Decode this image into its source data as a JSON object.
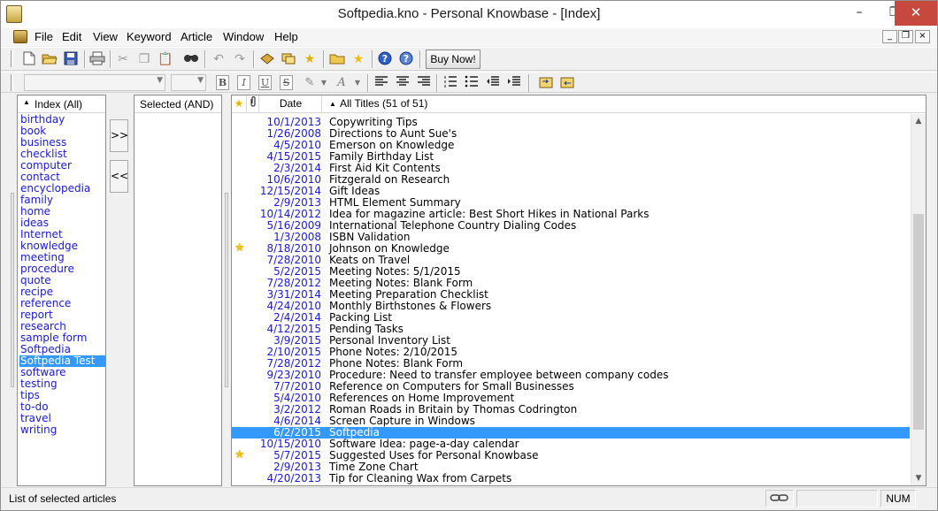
{
  "window": {
    "title": "Softpedia.kno - Personal Knowbase - [Index]",
    "controls": {
      "minimize": "–",
      "restore": "❐",
      "close": "✕"
    }
  },
  "menu": {
    "items": [
      "File",
      "Edit",
      "View",
      "Keyword",
      "Article",
      "Window",
      "Help"
    ],
    "mdi": {
      "minimize": "_",
      "restore": "❐",
      "close": "×"
    }
  },
  "toolbar": {
    "buy_now": "Buy Now!",
    "icons": [
      "new-document-icon",
      "open-folder-icon",
      "save-icon",
      "print-icon",
      "cut-icon",
      "copy-icon",
      "paste-icon",
      "find-icon",
      "undo-icon",
      "redo-icon",
      "knowbase-icon",
      "link-icon",
      "favorites-star-icon",
      "folder-icon",
      "star-icon",
      "help-icon",
      "context-help-icon"
    ],
    "format": {
      "bold": "B",
      "italic": "I",
      "underline": "U",
      "strike": "S"
    }
  },
  "index_panel": {
    "header": "Index (All)",
    "sort_indicator": "▲",
    "items": [
      "birthday",
      "book",
      "business",
      "checklist",
      "computer",
      "contact",
      "encyclopedia",
      "family",
      "home",
      "ideas",
      "Internet",
      "knowledge",
      "meeting",
      "procedure",
      "quote",
      "recipe",
      "reference",
      "report",
      "research",
      "sample form",
      "Softpedia",
      "Softpedia Test",
      "software",
      "testing",
      "tips",
      "to-do",
      "travel",
      "writing"
    ],
    "selected": "Softpedia Test"
  },
  "transfer": {
    "add": ">>",
    "remove": "<<"
  },
  "selected_panel": {
    "header": "Selected (AND)"
  },
  "articles": {
    "col_star": "★",
    "col_attach": "📎",
    "col_date": "Date",
    "col_title": "All Titles (51 of 51)",
    "sort_indicator": "▲",
    "rows": [
      {
        "date": "10/1/2013",
        "title": "Copywriting Tips",
        "star": false
      },
      {
        "date": "1/26/2008",
        "title": "Directions to Aunt Sue's",
        "star": false
      },
      {
        "date": "4/5/2010",
        "title": "Emerson on Knowledge",
        "star": false
      },
      {
        "date": "4/15/2015",
        "title": "Family Birthday List",
        "star": false
      },
      {
        "date": "2/3/2014",
        "title": "First Aid Kit Contents",
        "star": false
      },
      {
        "date": "10/6/2010",
        "title": "Fitzgerald on Research",
        "star": false
      },
      {
        "date": "12/15/2014",
        "title": "Gift Ideas",
        "star": false
      },
      {
        "date": "2/9/2013",
        "title": "HTML Element Summary",
        "star": false
      },
      {
        "date": "10/14/2012",
        "title": "Idea for magazine article: Best Short Hikes in National Parks",
        "star": false
      },
      {
        "date": "5/16/2009",
        "title": "International Telephone Country Dialing Codes",
        "star": false
      },
      {
        "date": "1/3/2008",
        "title": "ISBN Validation",
        "star": false
      },
      {
        "date": "8/18/2010",
        "title": "Johnson on Knowledge",
        "star": true
      },
      {
        "date": "7/28/2010",
        "title": "Keats on Travel",
        "star": false
      },
      {
        "date": "5/2/2015",
        "title": "Meeting Notes: 5/1/2015",
        "star": false
      },
      {
        "date": "7/28/2012",
        "title": "Meeting Notes: Blank Form",
        "star": false
      },
      {
        "date": "3/31/2014",
        "title": "Meeting Preparation Checklist",
        "star": false
      },
      {
        "date": "4/24/2010",
        "title": "Monthly Birthstones & Flowers",
        "star": false
      },
      {
        "date": "2/4/2014",
        "title": "Packing List",
        "star": false
      },
      {
        "date": "4/12/2015",
        "title": "Pending Tasks",
        "star": false
      },
      {
        "date": "3/9/2015",
        "title": "Personal Inventory List",
        "star": false
      },
      {
        "date": "2/10/2015",
        "title": "Phone Notes: 2/10/2015",
        "star": false
      },
      {
        "date": "7/28/2012",
        "title": "Phone Notes: Blank Form",
        "star": false
      },
      {
        "date": "9/23/2010",
        "title": "Procedure: Need to transfer employee between company codes",
        "star": false
      },
      {
        "date": "7/7/2010",
        "title": "Reference on Computers for Small Businesses",
        "star": false
      },
      {
        "date": "5/4/2010",
        "title": "References on Home Improvement",
        "star": false
      },
      {
        "date": "3/2/2012",
        "title": "Roman Roads in Britain by Thomas Codrington",
        "star": false
      },
      {
        "date": "4/6/2014",
        "title": "Screen Capture in Windows",
        "star": false
      },
      {
        "date": "6/2/2015",
        "title": "Softpedia",
        "star": false
      },
      {
        "date": "10/15/2010",
        "title": "Software Idea: page-a-day calendar",
        "star": false
      },
      {
        "date": "5/7/2015",
        "title": "Suggested Uses for Personal Knowbase",
        "star": true
      },
      {
        "date": "2/9/2013",
        "title": "Time Zone Chart",
        "star": false
      },
      {
        "date": "4/20/2013",
        "title": "Tip for Cleaning Wax from Carpets",
        "star": false
      }
    ],
    "selected": "Softpedia",
    "scroll": {
      "up": "▲",
      "down": "▼",
      "thumb_start_fraction": 0.25,
      "thumb_end_fraction": 0.88
    }
  },
  "status": {
    "message": "List of selected articles",
    "num": "NUM",
    "link_icon": "link-icon"
  }
}
